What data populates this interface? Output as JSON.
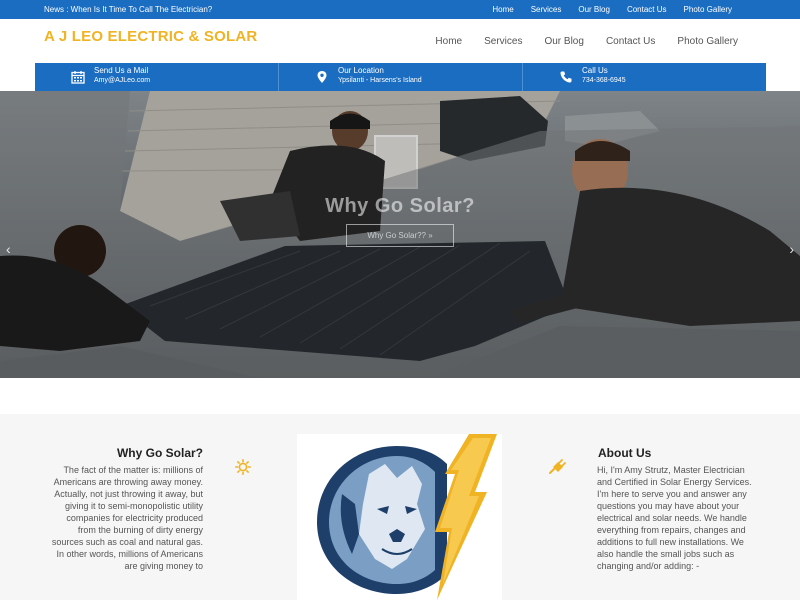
{
  "topbar": {
    "news": "News : When Is It Time To Call The Electrician?",
    "links": [
      "Home",
      "Services",
      "Our Blog",
      "Contact Us",
      "Photo Gallery"
    ]
  },
  "header": {
    "logo": "A J LEO ELECTRIC & SOLAR",
    "nav": [
      "Home",
      "Services",
      "Our Blog",
      "Contact Us",
      "Photo Gallery"
    ]
  },
  "contact": {
    "mail": {
      "label": "Send Us a Mail",
      "value": "Amy@AJLeo.com",
      "icon": "calendar-icon"
    },
    "location": {
      "label": "Our Location",
      "value": "Ypsilanti - Harsens's Island",
      "icon": "map-pin-icon"
    },
    "phone": {
      "label": "Call Us",
      "value": "734-368-6945",
      "icon": "phone-icon"
    }
  },
  "hero": {
    "title": "Why Go Solar?",
    "button": "Why Go Solar?? »",
    "prev": "‹",
    "next": "›"
  },
  "why": {
    "title": "Why Go Solar?",
    "text": "The fact of the matter is: millions of Americans are throwing away money. Actually, not just throwing it away, but giving it to semi-monopolistic utility companies for electricity produced from the burning of dirty energy sources such as coal and natural gas. In other words, millions of Americans are giving money to"
  },
  "about": {
    "title": "About Us",
    "text": "Hi, I'm Amy Strutz, Master Electrician and Certified in Solar Energy Services. I'm here to serve you and answer any questions you may have about your electrical and solar needs. We handle everything from repairs, changes and additions to full new installations. We also handle the small jobs such as changing and/or adding: -"
  },
  "colors": {
    "brand_blue": "#1b6dc1",
    "logo_gold": "#f0b323"
  }
}
